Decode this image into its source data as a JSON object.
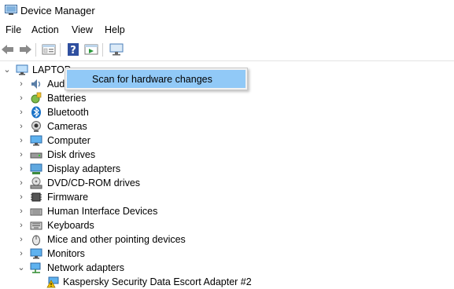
{
  "window": {
    "title": "Device Manager"
  },
  "menu": [
    "File",
    "Action",
    "View",
    "Help"
  ],
  "toolbar_icons": [
    "back-arrow-icon",
    "forward-arrow-icon",
    "properties-icon",
    "help-icon",
    "update-driver-icon",
    "scan-monitor-icon"
  ],
  "tree": {
    "root_label": "LAPTOP",
    "items": [
      {
        "label": "Audio inputs and outputs",
        "visible": "Aud",
        "icon": "audio-icon"
      },
      {
        "label": "Batteries",
        "icon": "battery-icon"
      },
      {
        "label": "Bluetooth",
        "icon": "bluetooth-icon"
      },
      {
        "label": "Cameras",
        "icon": "camera-icon"
      },
      {
        "label": "Computer",
        "icon": "computer-icon"
      },
      {
        "label": "Disk drives",
        "icon": "disk-drive-icon"
      },
      {
        "label": "Display adapters",
        "icon": "display-adapter-icon"
      },
      {
        "label": "DVD/CD-ROM drives",
        "icon": "dvd-drive-icon"
      },
      {
        "label": "Firmware",
        "icon": "firmware-icon"
      },
      {
        "label": "Human Interface Devices",
        "icon": "hid-icon"
      },
      {
        "label": "Keyboards",
        "icon": "keyboard-icon"
      },
      {
        "label": "Mice and other pointing devices",
        "icon": "mouse-icon"
      },
      {
        "label": "Monitors",
        "icon": "monitor-icon"
      },
      {
        "label": "Network adapters",
        "icon": "network-adapter-icon",
        "expanded": true
      }
    ],
    "child": {
      "label": "Kaspersky Security Data Escort Adapter #2",
      "icon": "warning-network-icon"
    }
  },
  "context_menu": {
    "items": [
      "Scan for hardware changes"
    ]
  },
  "colors": {
    "highlight": "#91c9f7",
    "menu_bg": "#f2f2f2"
  }
}
